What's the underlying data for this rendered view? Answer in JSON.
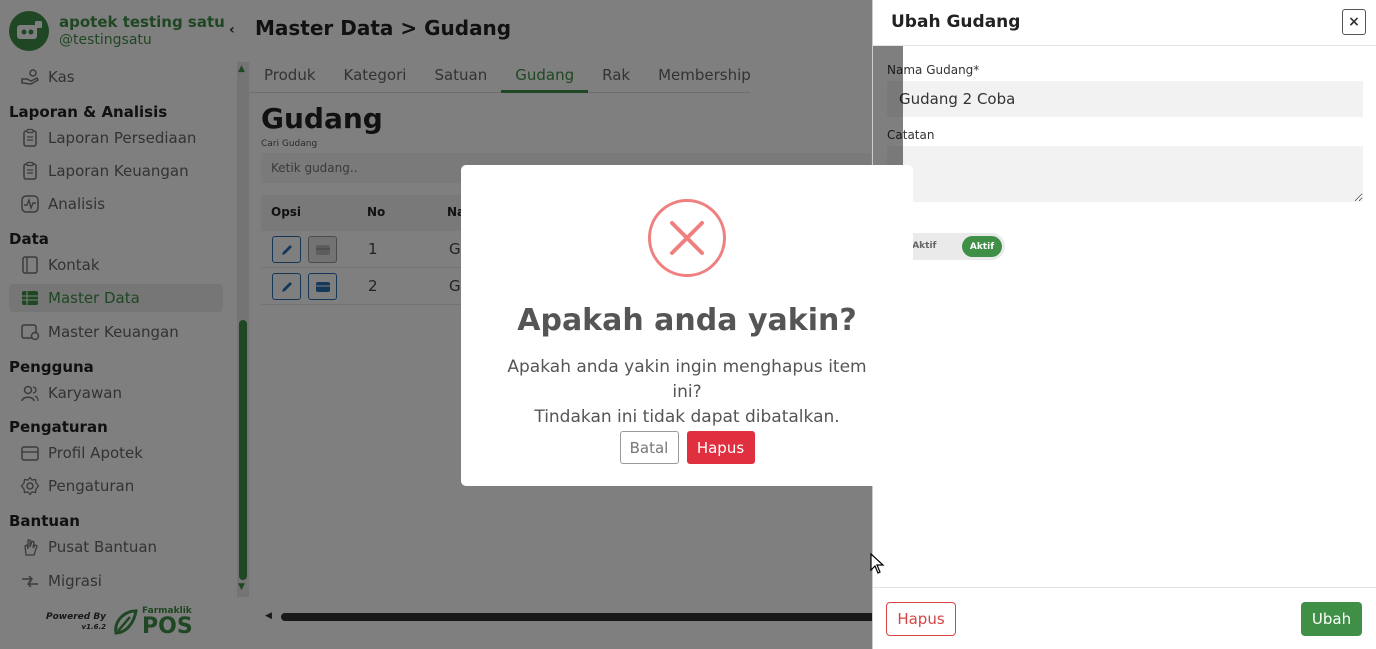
{
  "brand": {
    "name": "apotek testing satu",
    "handle": "@testingsatu"
  },
  "sidebar": {
    "top_item": {
      "label": "Kas",
      "icon": "hand-coins-icon"
    },
    "sections": [
      {
        "title": "Laporan & Analisis",
        "items": [
          {
            "label": "Laporan Persediaan",
            "icon": "clipboard-icon"
          },
          {
            "label": "Laporan Keuangan",
            "icon": "clipboard-icon"
          },
          {
            "label": "Analisis",
            "icon": "activity-icon"
          }
        ]
      },
      {
        "title": "Data",
        "items": [
          {
            "label": "Kontak",
            "icon": "contact-book-icon"
          },
          {
            "label": "Master Data",
            "icon": "table-icon",
            "active": true
          },
          {
            "label": "Master Keuangan",
            "icon": "card-icon"
          }
        ]
      },
      {
        "title": "Pengguna",
        "items": [
          {
            "label": "Karyawan",
            "icon": "users-icon"
          }
        ]
      },
      {
        "title": "Pengaturan",
        "items": [
          {
            "label": "Profil Apotek",
            "icon": "store-icon"
          },
          {
            "label": "Pengaturan",
            "icon": "gear-icon"
          }
        ]
      },
      {
        "title": "Bantuan",
        "items": [
          {
            "label": "Pusat Bantuan",
            "icon": "hand-icon"
          },
          {
            "label": "Migrasi",
            "icon": "migrate-icon"
          }
        ]
      }
    ],
    "powered_by": "Powered By",
    "version": "v1.6.2",
    "pos_small": "Farmaklik",
    "pos_big": "POS"
  },
  "main": {
    "breadcrumb": "Master Data > Gudang",
    "tabs": [
      "Produk",
      "Kategori",
      "Satuan",
      "Gudang",
      "Rak",
      "Membership"
    ],
    "active_tab": "Gudang",
    "section_title": "Gudang",
    "search_label": "Cari Gudang",
    "search_placeholder": "Ketik gudang..",
    "table": {
      "headers": [
        "Opsi",
        "No",
        "Na"
      ],
      "rows": [
        {
          "no": "1",
          "name": "G"
        },
        {
          "no": "2",
          "name": "G"
        }
      ]
    }
  },
  "drawer": {
    "title": "Ubah Gudang",
    "close": "×",
    "name_label": "Nama Gudang*",
    "name_value": "Gudang 2 Coba",
    "note_label": "Catatan",
    "status_label": "?",
    "toggle_off": "ak Aktif",
    "toggle_on": "Aktif",
    "delete_label": "Hapus",
    "submit_label": "Ubah"
  },
  "modal": {
    "title": "Apakah anda yakin?",
    "line1": "Apakah anda yakin ingin menghapus item ini?",
    "line2": "Tindakan ini tidak dapat dibatalkan.",
    "cancel": "Batal",
    "confirm": "Hapus",
    "icon": "error-x-icon"
  },
  "colors": {
    "brand_green": "#3f8f47",
    "danger": "#e0303f",
    "edit_blue": "#2a6fb0"
  }
}
